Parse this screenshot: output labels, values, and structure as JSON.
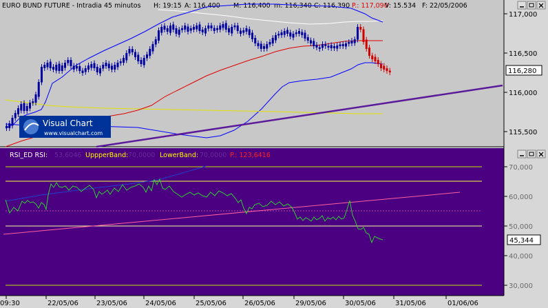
{
  "header": {
    "instrument": "EURO BUND FUTURE - Intradia 45 minutos",
    "h": "H: 19:15",
    "a": "A: 116,400",
    "m": "M: 116,400",
    "min": "m: 116,340",
    "c": "C: 116,390",
    "p": "P.: 117,090",
    "v": "V: 15.534",
    "f": "F: 22/05/2006"
  },
  "price_axis": {
    "ticks": [
      "117,000",
      "116,500",
      "116,000",
      "115,500"
    ],
    "current": "116,280"
  },
  "logo": {
    "brand": "Visual Chart",
    "url": "www.visualchart.com"
  },
  "rsi_header": {
    "rsi": "RSI_ED  RSI:",
    "rsi_val": "53,6046",
    "upper": "UppperBand:",
    "upper_val": "70,0000",
    "lower": "LowerBand:",
    "lower_val": "70,0000",
    "p": "P.: 123,6416"
  },
  "rsi_axis": {
    "ticks": [
      "70,000",
      "60,000",
      "50,000",
      "40,000",
      "30,000"
    ],
    "current": "45,344"
  },
  "time_axis": [
    "09:30",
    "22/05/06",
    "23/05/06",
    "24/05/06",
    "25/05/06",
    "26/05/06",
    "29/05/06",
    "30/05/06",
    "31/05/06",
    "01/06/06"
  ],
  "colors": {
    "price_bg": "#c8c8c8",
    "rsi_bg": "#4a0080",
    "candle": "#0000a0",
    "candle_down": "#d00000",
    "upper_band": "#ffffff",
    "lower_band": "#0000ff",
    "ma_red": "#e00000",
    "ma_yellow": "#e8e800",
    "trend": "#5a1a9a",
    "rsi_line": "#00c000"
  }
}
